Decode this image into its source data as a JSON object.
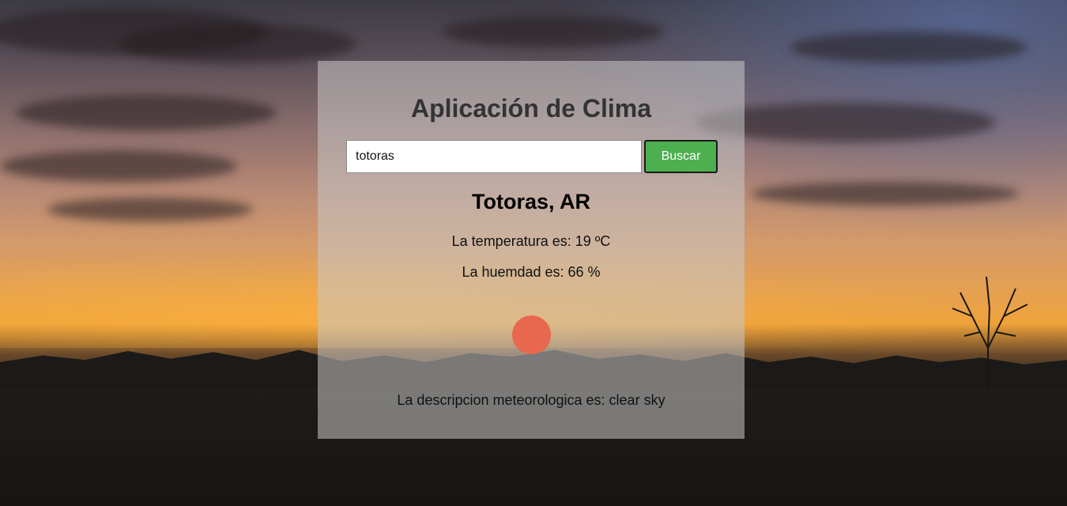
{
  "app": {
    "title": "Aplicación de Clima"
  },
  "search": {
    "value": "totoras",
    "button_label": "Buscar"
  },
  "weather": {
    "city": "Totoras, AR",
    "temperature_text": "La temperatura es: 19 ºC",
    "humidity_text": "La huemdad es: 66 %",
    "icon": "sun-icon",
    "description_text": "La descripcion meteorologica es: clear sky"
  },
  "colors": {
    "button_bg": "#4caf50",
    "icon_color": "#e8674f",
    "panel_bg": "rgba(200,200,200,0.55)"
  }
}
